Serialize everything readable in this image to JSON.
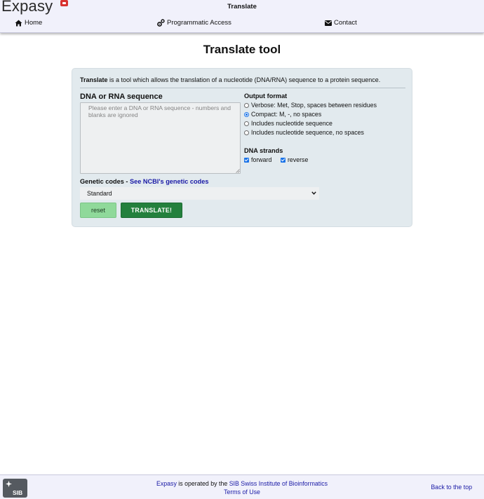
{
  "header": {
    "logo": "Expasy",
    "page_name": "Translate",
    "nav": {
      "home": "Home",
      "programmatic": "Programmatic Access",
      "contact": "Contact"
    }
  },
  "main": {
    "title": "Translate tool",
    "intro_bold": "Translate",
    "intro_rest": " is a tool which allows the translation of a nucleotide (DNA/RNA) sequence to a protein sequence.",
    "sequence": {
      "label": "DNA or RNA sequence",
      "placeholder": "Please enter a DNA or RNA sequence - numbers and blanks are ignored",
      "value": ""
    },
    "output_format": {
      "label": "Output format",
      "options": [
        {
          "label": "Verbose: Met, Stop, spaces between residues",
          "checked": false
        },
        {
          "label": "Compact: M, -, no spaces",
          "checked": true
        },
        {
          "label": "Includes nucleotide sequence",
          "checked": false
        },
        {
          "label": "Includes nucleotide sequence, no spaces",
          "checked": false
        }
      ]
    },
    "dna_strands": {
      "label": "DNA strands",
      "forward": {
        "label": "forward",
        "checked": true
      },
      "reverse": {
        "label": "reverse",
        "checked": true
      }
    },
    "genetic_codes": {
      "label": "Genetic codes - ",
      "link": "See NCBI's genetic codes",
      "selected": "Standard"
    },
    "buttons": {
      "reset": "reset",
      "translate": "TRANSLATE!"
    }
  },
  "footer": {
    "logo_text": "SIB",
    "line1_link1": "Expasy",
    "line1_mid": " is operated by the ",
    "line1_link2": "SIB Swiss Institute of Bioinformatics",
    "terms": "Terms of Use",
    "back_to_top": "Back to the top"
  },
  "colors": {
    "header_bg": "#f1f1fb",
    "panel_bg": "#e2eaee",
    "translate_button": "#23803d",
    "reset_button": "#8fd99a",
    "link": "#1a1aa6",
    "radio_checkbox_accent": "#1a73e8"
  }
}
